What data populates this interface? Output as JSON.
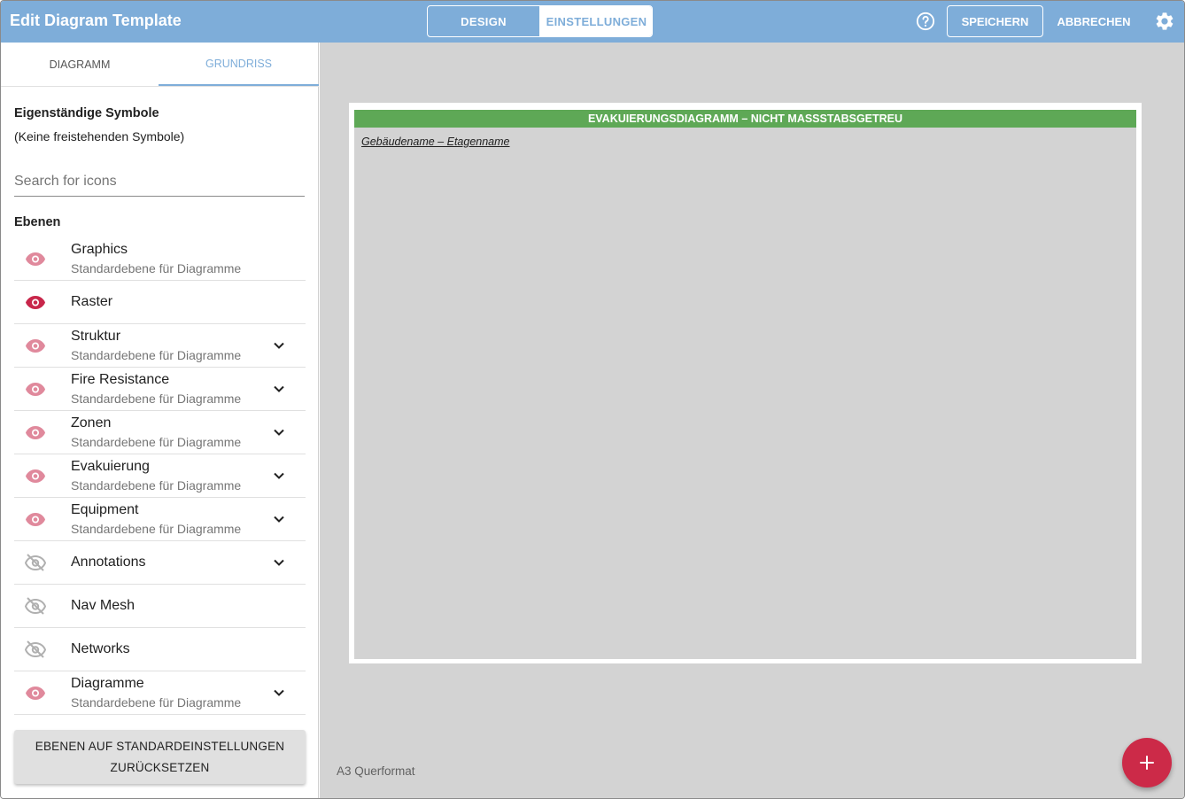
{
  "header": {
    "title": "Edit Diagram Template",
    "segments": [
      "DESIGN",
      "EINSTELLUNGEN"
    ],
    "active_segment": "EINSTELLUNGEN",
    "help_icon": "help-circle-icon",
    "save_label": "SPEICHERN",
    "cancel_label": "ABBRECHEN",
    "settings_icon": "gear-icon"
  },
  "sidebar": {
    "tabs": [
      "DIAGRAMM",
      "GRUNDRISS"
    ],
    "active_tab": "GRUNDRISS",
    "standalone_title": "Eigenständige Symbole",
    "standalone_empty": "(Keine freistehenden Symbole)",
    "search_placeholder": "Search for icons",
    "layers_title": "Ebenen",
    "layers": [
      {
        "name": "Graphics",
        "desc": "Standardebene für Diagramme",
        "visibility": "visible",
        "expandable": false
      },
      {
        "name": "Raster",
        "desc": "",
        "visibility": "visible-active",
        "expandable": false
      },
      {
        "name": "Struktur",
        "desc": "Standardebene für Diagramme",
        "visibility": "visible",
        "expandable": true
      },
      {
        "name": "Fire Resistance",
        "desc": "Standardebene für Diagramme",
        "visibility": "visible",
        "expandable": true
      },
      {
        "name": "Zonen",
        "desc": "Standardebene für Diagramme",
        "visibility": "visible",
        "expandable": true
      },
      {
        "name": "Evakuierung",
        "desc": "Standardebene für Diagramme",
        "visibility": "visible",
        "expandable": true
      },
      {
        "name": "Equipment",
        "desc": "Standardebene für Diagramme",
        "visibility": "visible",
        "expandable": true
      },
      {
        "name": "Annotations",
        "desc": "",
        "visibility": "hidden",
        "expandable": true
      },
      {
        "name": "Nav Mesh",
        "desc": "",
        "visibility": "hidden",
        "expandable": false
      },
      {
        "name": "Networks",
        "desc": "",
        "visibility": "hidden",
        "expandable": false
      },
      {
        "name": "Diagramme",
        "desc": "Standardebene für Diagramme",
        "visibility": "visible",
        "expandable": true
      }
    ],
    "reset_label_line1": "EBENEN AUF STANDARDEINSTELLUNGEN",
    "reset_label_line2": "ZURÜCKSETZEN"
  },
  "canvas": {
    "banner": "EVAKUIERUNGSDIAGRAMM – NICHT MASSSTABSGETREU",
    "building_label": "Gebäudename – Etagenname",
    "page_format": "A3 Querformat",
    "fab_icon": "plus-icon"
  },
  "colors": {
    "header_bg": "#7eadd9",
    "accent": "#7eadd9",
    "eye_visible": "#e0899c",
    "eye_active": "#c8264a",
    "eye_hidden": "#b0b0b0",
    "banner_green": "#5ea856",
    "fab": "#cc2a48",
    "canvas_bg": "#d3d3d3"
  }
}
